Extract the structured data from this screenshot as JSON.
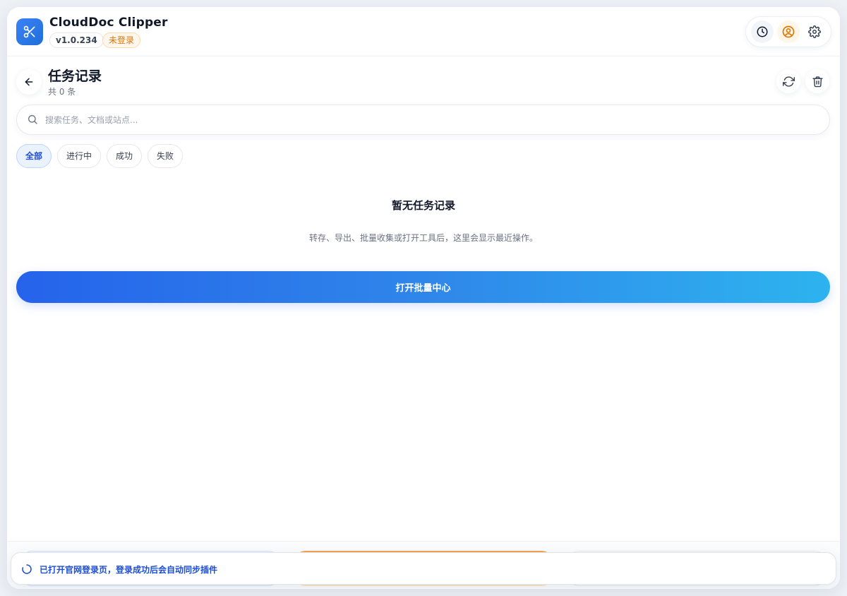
{
  "app": {
    "title": "CloudDoc Clipper",
    "version": "v1.0.234",
    "login_status": "未登录",
    "accent_color": "#2563eb",
    "warning_color": "#d97706"
  },
  "header_actions": [
    {
      "icon": "clock-icon"
    },
    {
      "icon": "user-circle-icon"
    },
    {
      "icon": "gear-icon"
    }
  ],
  "page": {
    "title": "任务记录",
    "subtitle": "共 0 条",
    "back_icon": "arrow-left-icon",
    "refresh_icon": "refresh-icon",
    "delete_icon": "trash-icon"
  },
  "search": {
    "placeholder": "搜索任务、文档或站点...",
    "value": ""
  },
  "filters": [
    {
      "label": "全部",
      "active": true
    },
    {
      "label": "进行中",
      "active": false
    },
    {
      "label": "成功",
      "active": false
    },
    {
      "label": "失败",
      "active": false
    }
  ],
  "empty_state": {
    "title": "暂无任务记录",
    "description": "转存、导出、批量收集或打开工具后，这里会显示最近操作。",
    "button_label": "打开批量中心"
  },
  "toast": {
    "message": "已打开官网登录页，登录成功后会自动同步插件",
    "icon": "spinner-icon"
  }
}
